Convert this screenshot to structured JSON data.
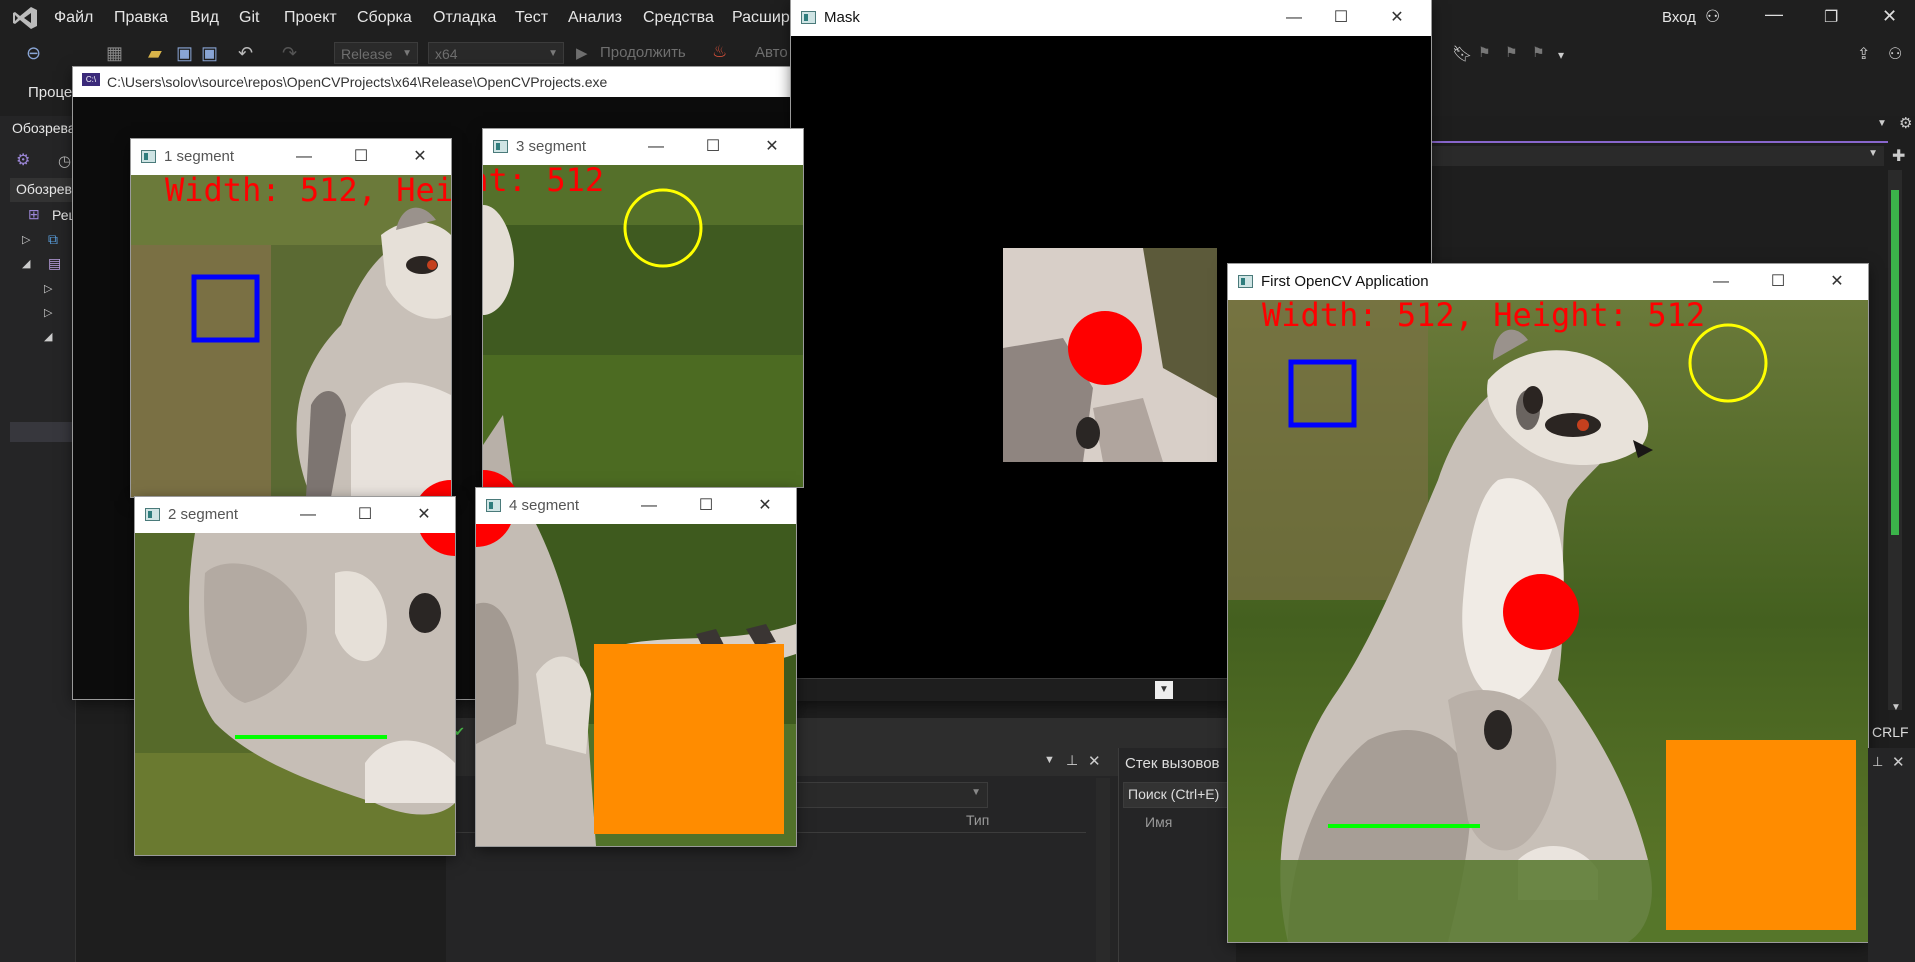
{
  "vs": {
    "menu": [
      "Файл",
      "Правка",
      "Вид",
      "Git",
      "Проект",
      "Сборка",
      "Отладка",
      "Тест",
      "Анализ",
      "Средства",
      "Расширения"
    ],
    "signin": "Вход",
    "config_combo": "Release",
    "platform_combo": "x64",
    "continue_label": "Продолжить",
    "auto_combo": "Авто",
    "process_label": "Процесс",
    "solution_explorer_title": "Обозреватель решений",
    "solution_explorer_tab": "Обозреватель решений",
    "tree_item": "Решение",
    "callstack_title": "Стек вызовов",
    "search_placeholder": "Поиск (Ctrl+E)",
    "col_type": "Тип",
    "col_name": "Имя",
    "status_crlf": "CRLF"
  },
  "console": {
    "title": "C:\\Users\\solov\\source\\repos\\OpenCVProjects\\x64\\Release\\OpenCVProjects.exe",
    "icon_text": "C:\\"
  },
  "image": {
    "overlay_text": "Width: 512, Height: 512",
    "colors": {
      "text": "#ff0000",
      "rect": "#0000ff",
      "circle_outline": "#ffff00",
      "circle_fill": "#ff0000",
      "line": "#00ff00",
      "orange": "#ff8c00"
    }
  },
  "windows": {
    "seg1": {
      "title": "1 segment"
    },
    "seg2": {
      "title": "2 segment"
    },
    "seg3": {
      "title": "3 segment"
    },
    "seg4": {
      "title": "4 segment"
    },
    "mask": {
      "title": "Mask"
    },
    "main": {
      "title": "First OpenCV Application"
    }
  },
  "controls": {
    "minimize": "—",
    "maximize": "☐",
    "close": "✕"
  }
}
